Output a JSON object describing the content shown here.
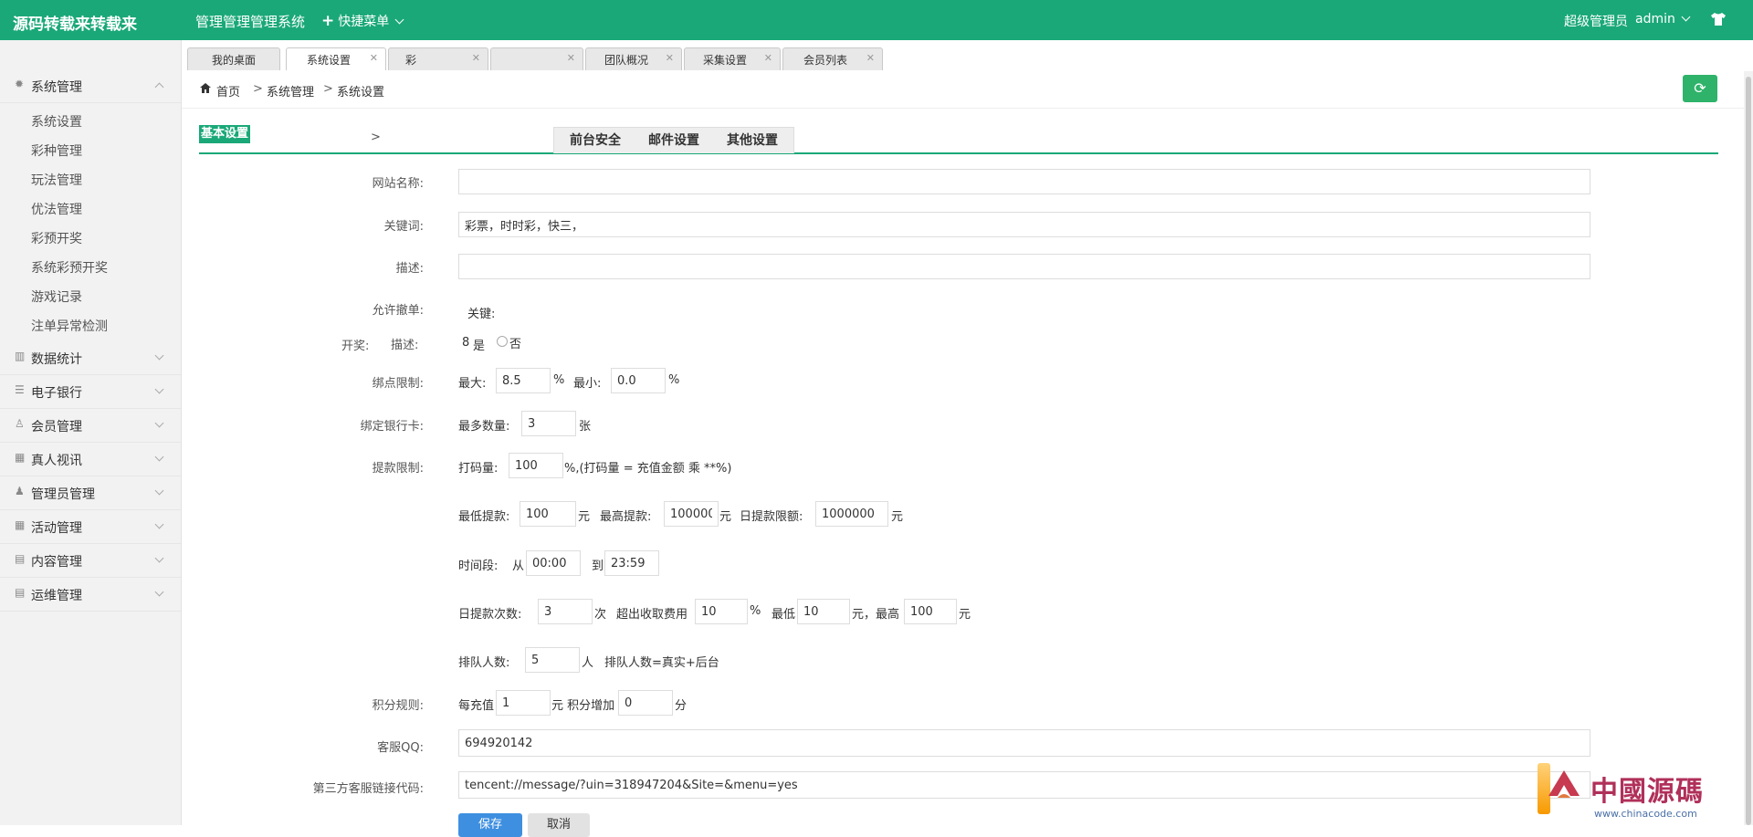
{
  "header": {
    "brand": "源码转载来转载来",
    "system_name": "管理管理管理系统",
    "quick_menu": "快捷菜单",
    "role": "超级管理员",
    "user": "admin",
    "skin_icon": "tshirt-icon",
    "accent_color": "#1aa878"
  },
  "sidebar": {
    "groups": [
      {
        "label": "系统管理",
        "icon": "gear-icon",
        "open": true,
        "items": [
          "系统设置",
          "彩种管理",
          "玩法管理",
          "优法管理",
          "彩预开奖",
          "系统彩预开奖",
          "游戏记录",
          "注单异常检测"
        ]
      },
      {
        "label": "数据统计",
        "icon": "chart-icon"
      },
      {
        "label": "电子银行",
        "icon": "list-icon"
      },
      {
        "label": "会员管理",
        "icon": "user-icon"
      },
      {
        "label": "真人视讯",
        "icon": "grid-icon"
      },
      {
        "label": "管理员管理",
        "icon": "admin-icon"
      },
      {
        "label": "活动管理",
        "icon": "grid-icon"
      },
      {
        "label": "内容管理",
        "icon": "doc-icon"
      },
      {
        "label": "运维管理",
        "icon": "server-icon"
      }
    ]
  },
  "tabs": [
    {
      "label": "我的桌面",
      "closable": false
    },
    {
      "label": "系统设置",
      "closable": true,
      "active": true
    },
    {
      "label": "彩",
      "closable": true
    },
    {
      "label": "",
      "closable": true
    },
    {
      "label": "团队概况",
      "closable": true
    },
    {
      "label": "采集设置",
      "closable": true
    },
    {
      "label": "会员列表",
      "closable": true
    }
  ],
  "breadcrumb": [
    "首页",
    "系统管理",
    "系统设置"
  ],
  "form_tabs": {
    "first": "基本设置",
    "items": [
      "前台安全",
      "邮件设置",
      "其他设置"
    ]
  },
  "form": {
    "site_name": {
      "label": "网站名称:",
      "value": ""
    },
    "keywords": {
      "label": "关键词:",
      "value": "彩票，时时彩，快三，"
    },
    "description": {
      "label": "描述:",
      "value": ""
    },
    "allow_cancel": {
      "label": "允许撤单:",
      "option": "关键:"
    },
    "open": {
      "label": "开奖:",
      "sub_label": "描述:",
      "value": "8",
      "yes": "是",
      "no": "否"
    },
    "rebate_limit": {
      "label": "绑点限制:",
      "max_label": "最大:",
      "max_value": "8.5",
      "min_label": "最小:",
      "min_value": "0.0",
      "unit": "%"
    },
    "bank_card": {
      "label": "绑定银行卡:",
      "max_count_label": "最多数量:",
      "max_count": "3",
      "unit": "张"
    },
    "withdraw_limit": {
      "label": "提款限制:",
      "bet_label": "打码量:",
      "bet_value": "100",
      "bet_note": "%,(打码量 = 充值金额 乘 **%)",
      "min_label": "最低提款:",
      "min_value": "100",
      "max_label": "最高提款:",
      "max_value": "100000",
      "daily_label": "日提款限额:",
      "daily_value": "1000000",
      "currency": "元",
      "time_label": "时间段:",
      "from_label": "从",
      "from_value": "00:00",
      "to_label": "到",
      "to_value": "23:59",
      "times_label": "日提款次数:",
      "times_value": "3",
      "times_unit": "次",
      "fee_label": "超出收取费用",
      "fee_value": "10",
      "fee_unit": "%",
      "fee_min_label": "最低",
      "fee_min_value": "10",
      "fee_max_label": "元，最高",
      "fee_max_value": "100",
      "queue_label": "排队人数:",
      "queue_value": "5",
      "queue_unit": "人",
      "queue_note": "排队人数=真实+后台"
    },
    "points_rule": {
      "label": "积分规则:",
      "prefix": "每充值",
      "recharge_value": "1",
      "mid": "元 积分增加",
      "points_value": "0",
      "unit": "分"
    },
    "qq": {
      "label": "客服QQ:",
      "value": "694920142"
    },
    "third_party": {
      "label": "第三方客服链接代码:",
      "value": "tencent://message/?uin=318947204&Site=&menu=yes"
    },
    "save_label": "保存",
    "cancel_label": "取消"
  },
  "watermark": {
    "text": "中國源碼",
    "url": "www.chinacode.com"
  }
}
